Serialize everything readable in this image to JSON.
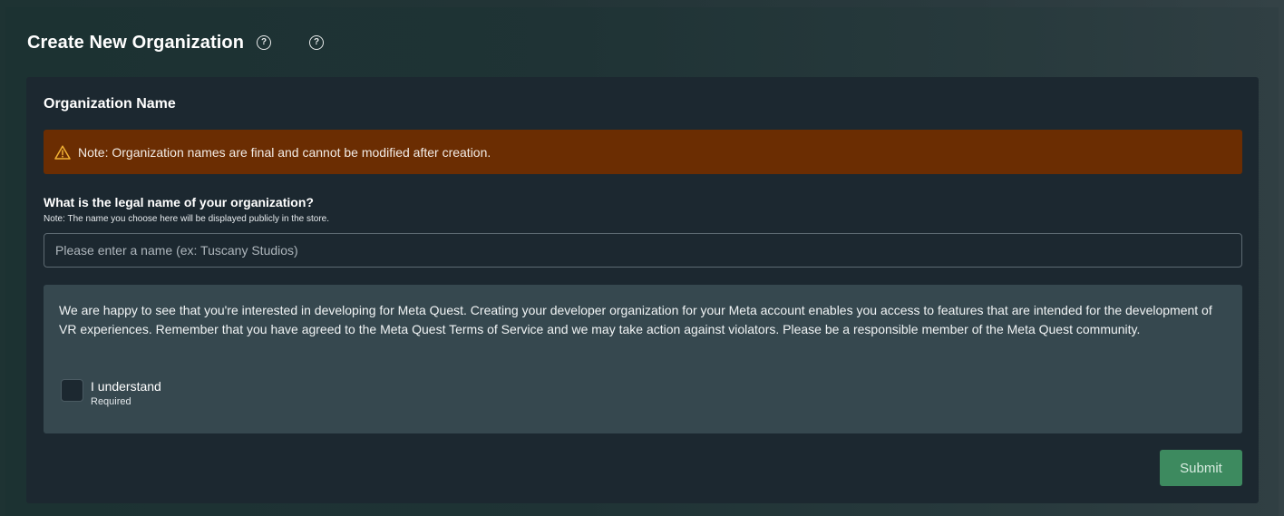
{
  "page": {
    "title": "Create New Organization",
    "help_icons": [
      "help-circle-icon",
      "help-circle-icon"
    ]
  },
  "org_name_section": {
    "title": "Organization Name",
    "warning": {
      "icon": "warning-triangle-icon",
      "text": "Note: Organization names are final and cannot be modified after creation.",
      "color": "#6b2d02"
    },
    "question": "What is the legal name of your organization?",
    "question_note": "Note: The name you choose here will be displayed publicly in the store.",
    "name_input": {
      "value": "",
      "placeholder": "Please enter a name (ex: Tuscany Studios)"
    }
  },
  "terms": {
    "text": "We are happy to see that you're interested in developing for Meta Quest. Creating your developer organization for your Meta account enables you access to features that are intended for the development of VR experiences. Remember that you have agreed to the Meta Quest Terms of Service and we may take action against violators. Please be a responsible member of the Meta Quest community.",
    "checkbox_label": "I understand",
    "checkbox_required": "Required",
    "checked": false
  },
  "actions": {
    "submit_label": "Submit",
    "submit_color": "#3d8a5f"
  }
}
